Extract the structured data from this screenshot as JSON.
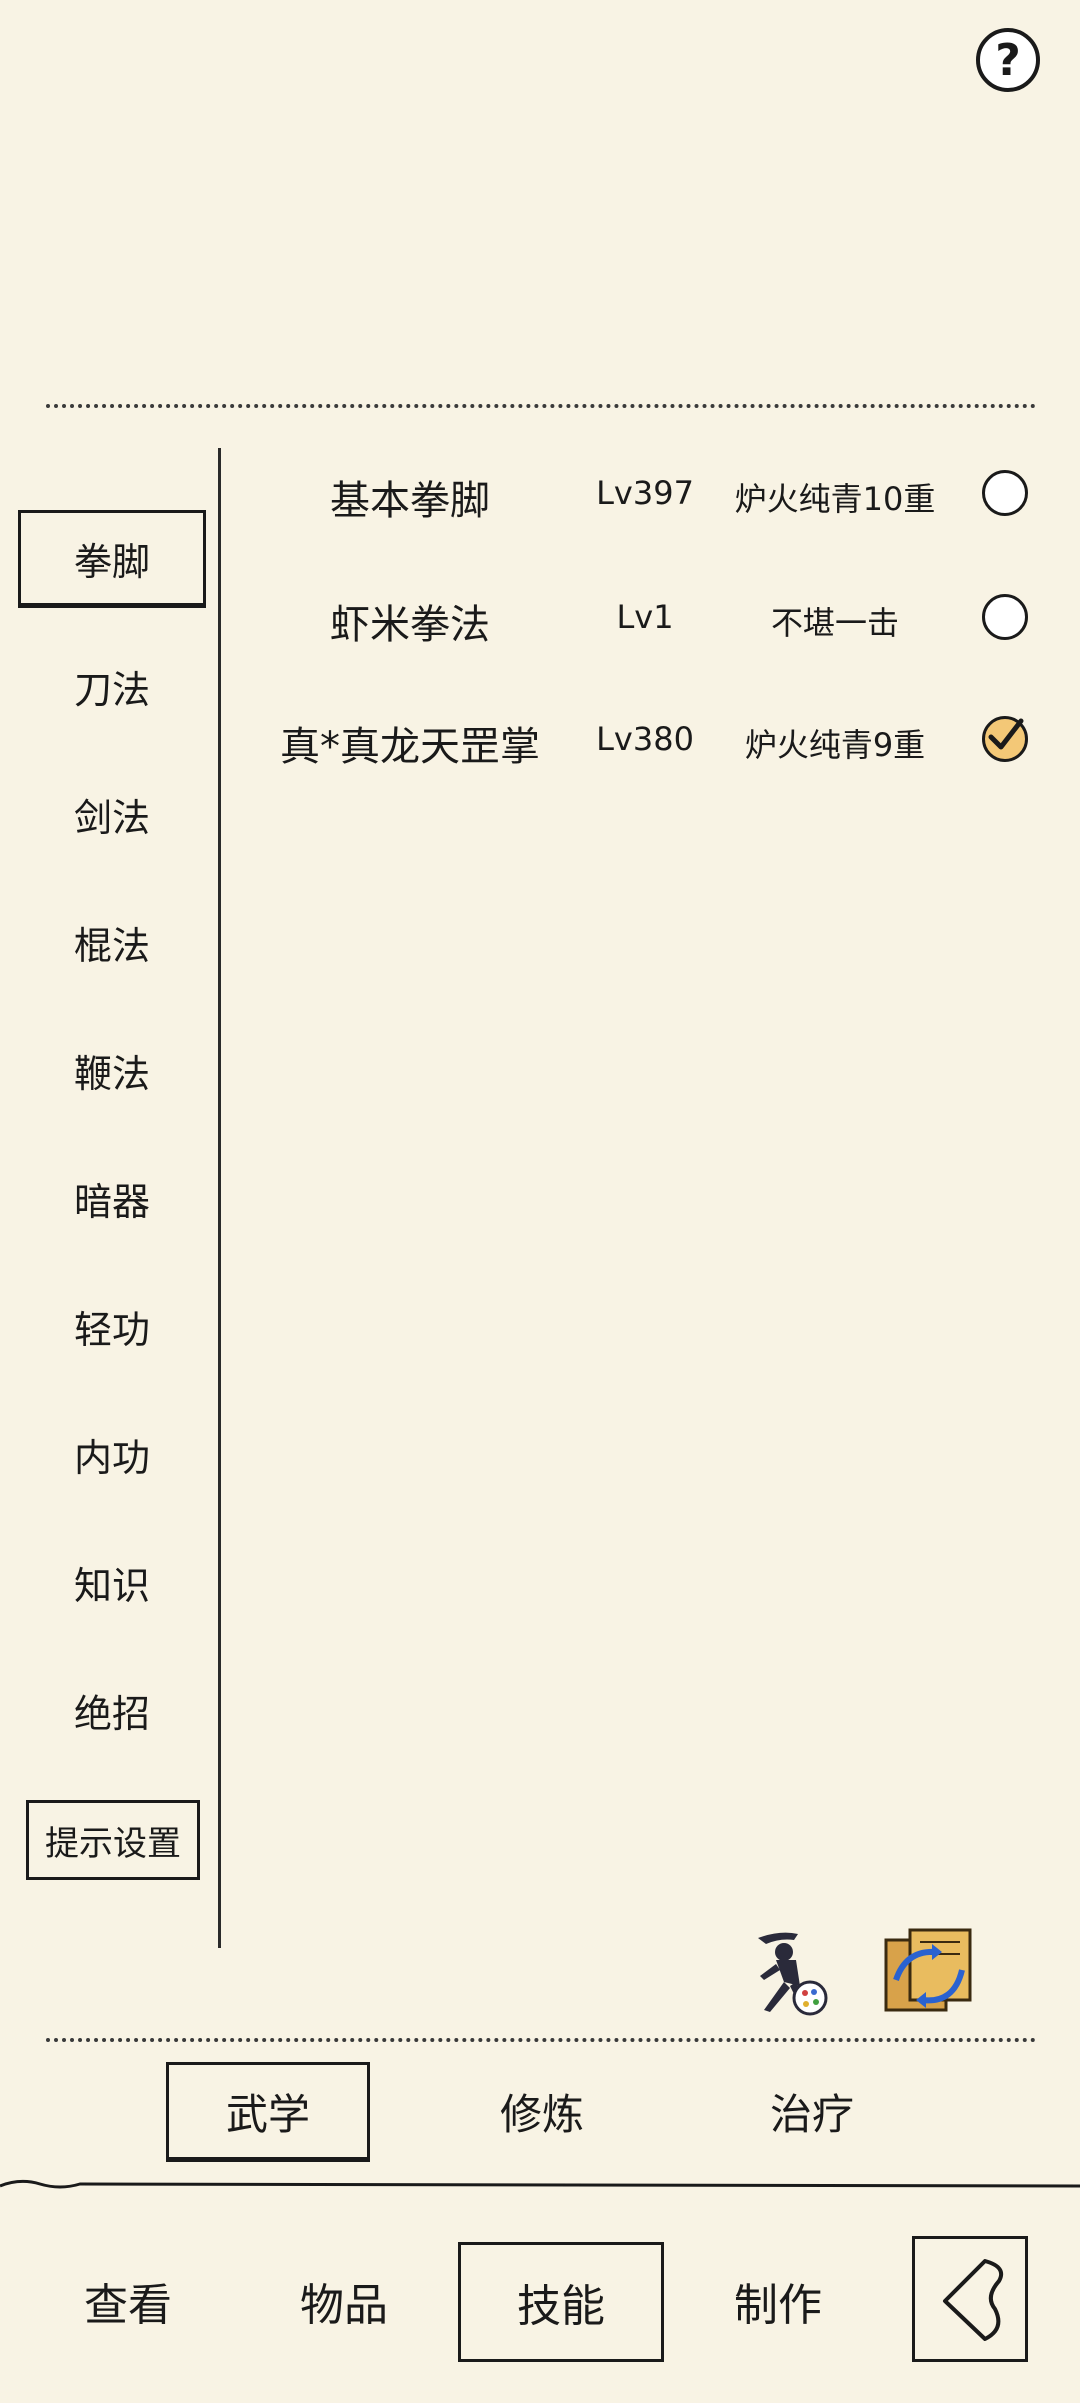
{
  "help": {
    "label": "?"
  },
  "categories": [
    {
      "label": "拳脚",
      "active": true
    },
    {
      "label": "刀法"
    },
    {
      "label": "剑法"
    },
    {
      "label": "棍法"
    },
    {
      "label": "鞭法"
    },
    {
      "label": "暗器"
    },
    {
      "label": "轻功"
    },
    {
      "label": "内功"
    },
    {
      "label": "知识"
    },
    {
      "label": "绝招"
    }
  ],
  "hint_settings": {
    "label": "提示设置"
  },
  "skills": [
    {
      "name": "基本拳脚",
      "level": "Lv397",
      "rank": "炉火纯青10重",
      "selected": false
    },
    {
      "name": "虾米拳法",
      "level": "Lv1",
      "rank": "不堪一击",
      "selected": false
    },
    {
      "name": "真*真龙天罡掌",
      "level": "Lv380",
      "rank": "炉火纯青9重",
      "selected": true
    }
  ],
  "tool_icons": [
    "martial-artist-icon",
    "scroll-swap-icon"
  ],
  "tabs": [
    {
      "label": "武学",
      "active": true
    },
    {
      "label": "修炼"
    },
    {
      "label": "治疗"
    }
  ],
  "bottom_nav": [
    {
      "label": "查看"
    },
    {
      "label": "物品"
    },
    {
      "label": "技能",
      "active": true
    },
    {
      "label": "制作"
    }
  ],
  "back_icon": "back-arrow-icon",
  "colors": {
    "background": "#f8f3e4",
    "ink": "#1a1a1a",
    "check_fill": "#f3c877"
  }
}
